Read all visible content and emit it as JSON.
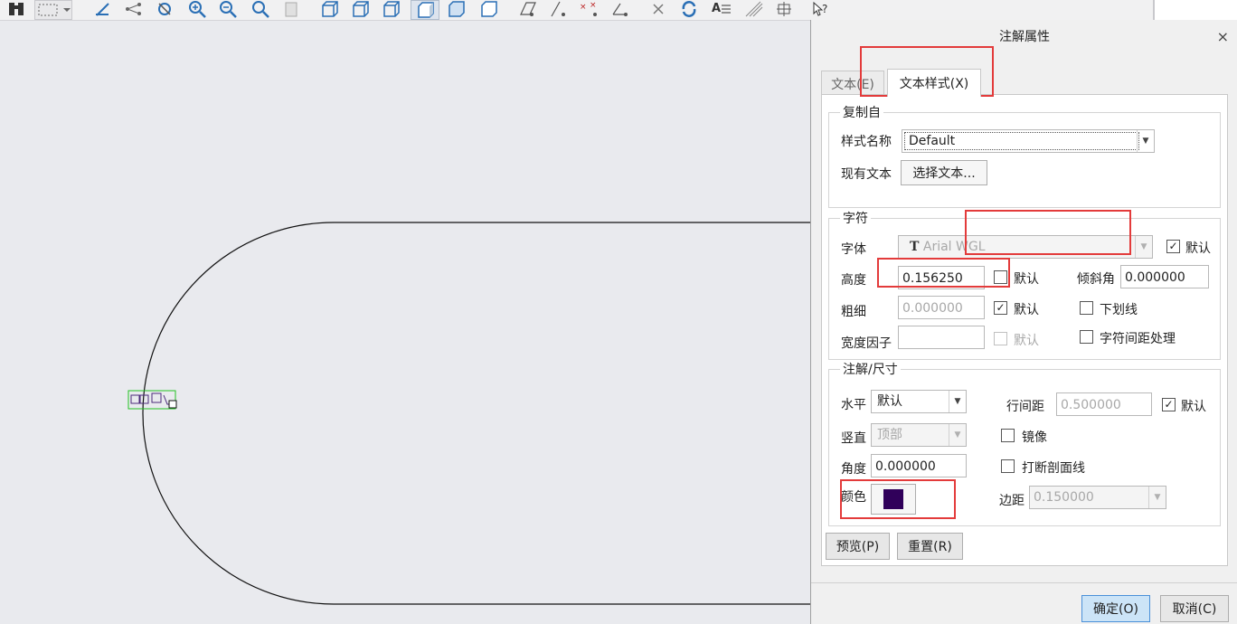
{
  "toolbar": {
    "icons": [
      "binoculars-icon",
      "select-box-icon",
      "dropdown-icon",
      "sketch-icon",
      "nodes-icon",
      "repaint-icon",
      "zoom-in-icon",
      "zoom-out-icon",
      "zoom-fit-icon",
      "saved-view-icon",
      "wireframe-icon",
      "hidden-line-icon",
      "no-hidden-icon",
      "shading-icon",
      "shaded-edges-icon",
      "shading-reflections-icon",
      "plane-display-icon",
      "axis-display-icon",
      "point-display-icon",
      "csys-display-icon",
      "delete-icon",
      "refresh-icon",
      "text-style-icon",
      "hatch-icon",
      "annotation-icon",
      "help-icon"
    ]
  },
  "dialog": {
    "title": "注解属性",
    "close": "×",
    "tabs": [
      "文本(E)",
      "文本样式(X)"
    ],
    "copy_from": {
      "label": "复制自",
      "style_name_label": "样式名称",
      "style_name_value": "Default",
      "existing_text_label": "现有文本",
      "select_text_button": "选择文本..."
    },
    "character": {
      "label": "字符",
      "font_label": "字体",
      "font_icon": "T",
      "font_value": "Arial WGL",
      "font_default_label": "默认",
      "font_default_checked": true,
      "height_label": "高度",
      "height_value": "0.156250",
      "height_default_label": "默认",
      "height_default_checked": false,
      "slant_label": "倾斜角",
      "slant_value": "0.000000",
      "thickness_label": "粗细",
      "thickness_value": "0.000000",
      "thickness_default_label": "默认",
      "thickness_default_checked": true,
      "underline_label": "下划线",
      "underline_checked": false,
      "width_factor_label": "宽度因子",
      "width_factor_value": "",
      "width_default_label": "默认",
      "kerning_label": "字符间距处理",
      "kerning_checked": false
    },
    "annotation": {
      "label": "注解/尺寸",
      "horizontal_label": "水平",
      "horizontal_value": "默认",
      "line_spacing_label": "行间距",
      "line_spacing_value": "0.500000",
      "line_spacing_default_label": "默认",
      "line_spacing_default_checked": true,
      "vertical_label": "竖直",
      "vertical_value": "顶部",
      "mirror_label": "镜像",
      "mirror_checked": false,
      "angle_label": "角度",
      "angle_value": "0.000000",
      "break_hatch_label": "打断剖面线",
      "break_hatch_checked": false,
      "color_label": "颜色",
      "color_value": "#30005a",
      "margin_label": "边距",
      "margin_value": "0.150000"
    },
    "buttons": {
      "preview": "预览(P)",
      "reset": "重置(R)",
      "ok": "确定(O)",
      "cancel": "取消(C)"
    }
  }
}
